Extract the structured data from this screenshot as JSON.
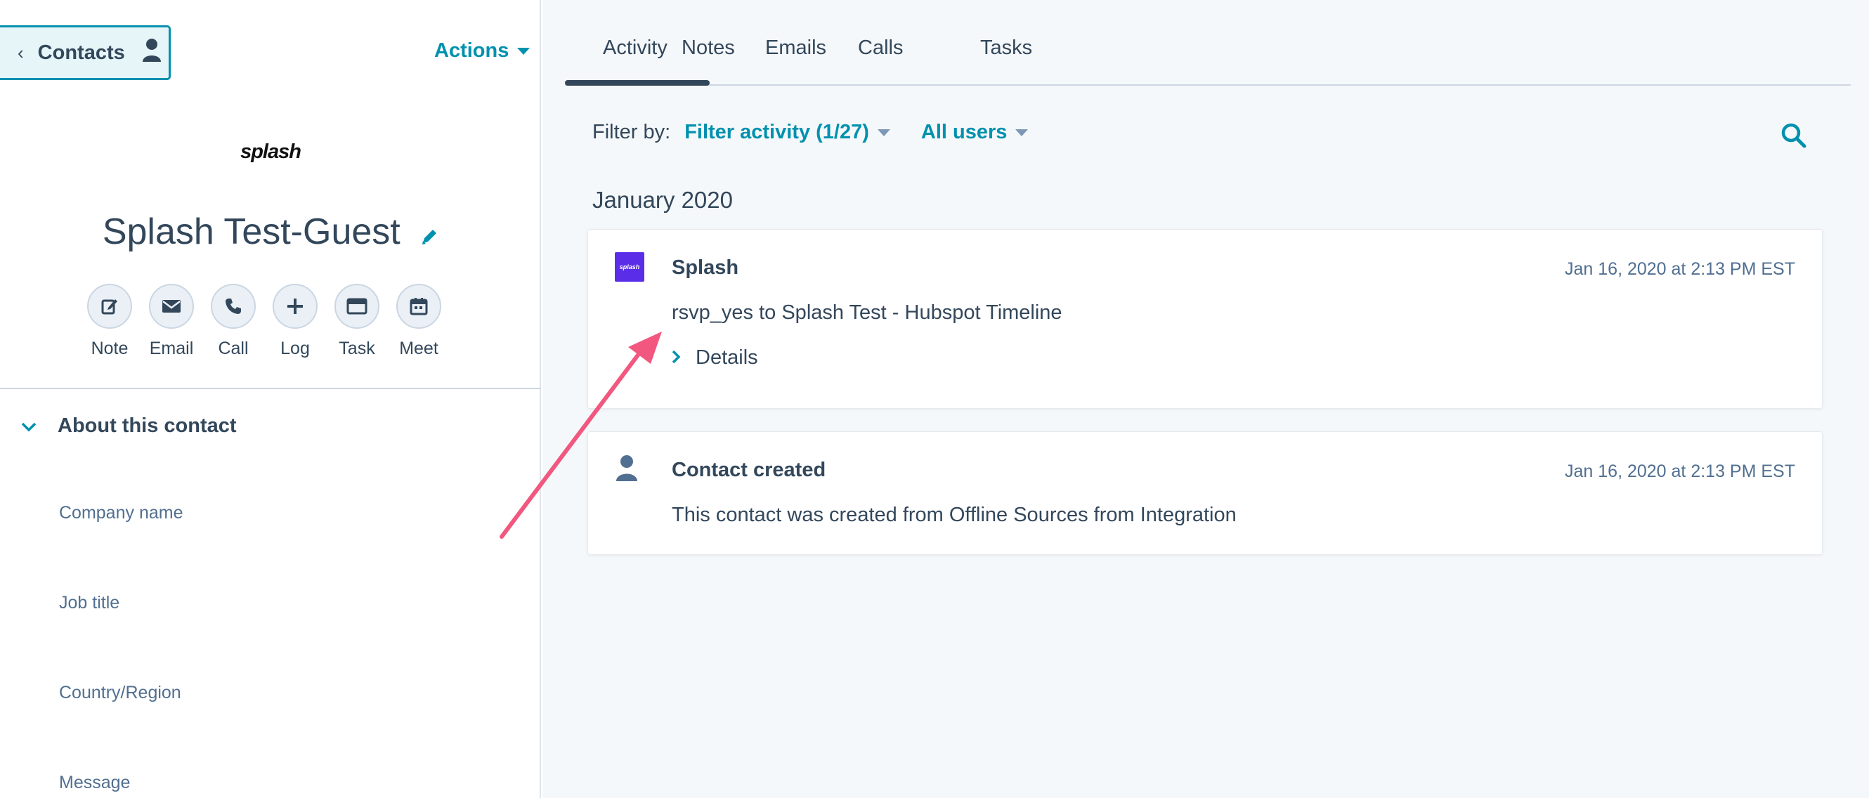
{
  "sidebar": {
    "back_label": "Contacts",
    "actions_label": "Actions",
    "company_logo_text": "splash",
    "contact_name": "Splash Test-Guest",
    "quick_actions": [
      {
        "label": "Note",
        "icon": "note-edit-icon"
      },
      {
        "label": "Email",
        "icon": "envelope-icon"
      },
      {
        "label": "Call",
        "icon": "phone-icon"
      },
      {
        "label": "Log",
        "icon": "plus-icon"
      },
      {
        "label": "Task",
        "icon": "task-icon"
      },
      {
        "label": "Meet",
        "icon": "calendar-icon"
      }
    ],
    "about_section_title": "About this contact",
    "properties": [
      "Company name",
      "Job title",
      "Country/Region",
      "Message"
    ]
  },
  "main": {
    "tabs": [
      "Activity",
      "Notes",
      "Emails",
      "Calls",
      "Tasks"
    ],
    "active_tab": "Activity",
    "filter": {
      "label": "Filter by:",
      "activity_filter": "Filter activity (1/27)",
      "users_filter": "All users"
    },
    "month_header": "January 2020",
    "timeline": [
      {
        "icon": "splash-logo-icon",
        "icon_text": "splash",
        "title": "Splash",
        "timestamp": "Jan 16, 2020 at 2:13 PM EST",
        "body": "rsvp_yes to Splash Test - Hubspot Timeline",
        "details_label": "Details"
      },
      {
        "icon": "person-icon",
        "title": "Contact created",
        "timestamp": "Jan 16, 2020 at 2:13 PM EST",
        "body": "This contact was created from Offline Sources from Integration"
      }
    ]
  },
  "colors": {
    "accent": "#0091ae",
    "text": "#33475b",
    "secondary_text": "#516f90",
    "main_bg": "#f5f8fa",
    "annotation_arrow": "#f2577f",
    "splash_brand": "#5a2ee8"
  }
}
